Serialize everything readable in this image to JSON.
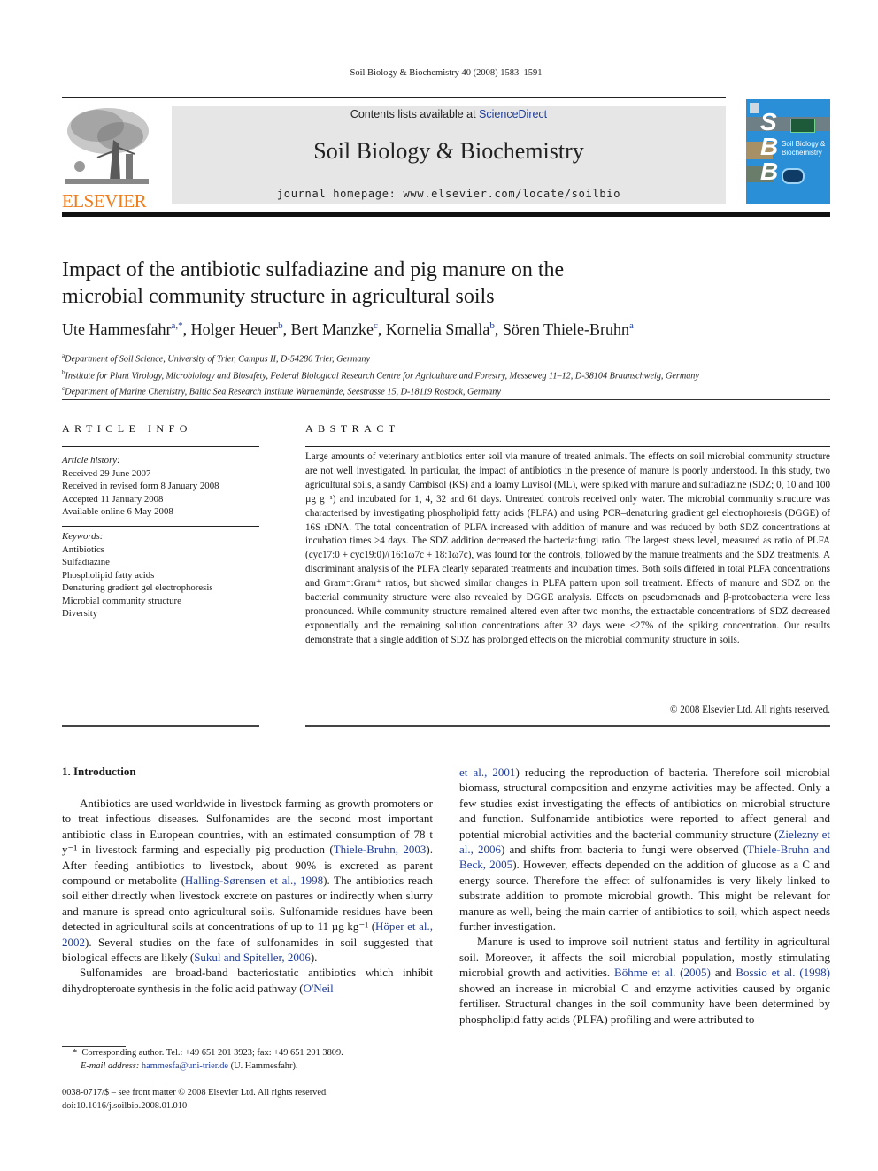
{
  "header": {
    "running_title": "Soil Biology & Biochemistry 40 (2008) 1583–1591",
    "contents_prefix": "Contents lists available at ",
    "contents_link": "ScienceDirect",
    "journal_title": "Soil Biology & Biochemistry",
    "homepage": "journal homepage: www.elsevier.com/locate/soilbio",
    "publisher_logo": "ELSEVIER",
    "cover": {
      "letters": [
        "S",
        "B",
        "B"
      ],
      "title_line1": "Soil Biology &",
      "title_line2": "Biochemistry"
    }
  },
  "colors": {
    "link": "#1f3d99",
    "elsevier_orange": "#f07d1c",
    "cover_blue": "#2a8fd6",
    "banner_gray": "#e6e6e6"
  },
  "article": {
    "title_line1": "Impact of the antibiotic sulfadiazine and pig manure on the",
    "title_line2": "microbial community structure in agricultural soils",
    "authors": [
      {
        "name": "Ute Hammesfahr",
        "sup": "a,*"
      },
      {
        "name": "Holger Heuer",
        "sup": "b"
      },
      {
        "name": "Bert Manzke",
        "sup": "c"
      },
      {
        "name": "Kornelia Smalla",
        "sup": "b"
      },
      {
        "name": "Sören Thiele-Bruhn",
        "sup": "a"
      }
    ],
    "affiliations": [
      {
        "sup": "a",
        "text": "Department of Soil Science, University of Trier, Campus II, D-54286 Trier, Germany"
      },
      {
        "sup": "b",
        "text": "Institute for Plant Virology, Microbiology and Biosafety, Federal Biological Research Centre for Agriculture and Forestry, Messeweg 11–12, D-38104 Braunschweig, Germany"
      },
      {
        "sup": "c",
        "text": "Department of Marine Chemistry, Baltic Sea Research Institute Warnemünde, Seestrasse 15, D-18119 Rostock, Germany"
      }
    ]
  },
  "article_info": {
    "heading": "ARTICLE INFO",
    "history_label": "Article history:",
    "history": [
      "Received 29 June 2007",
      "Received in revised form 8 January 2008",
      "Accepted 11 January 2008",
      "Available online 6 May 2008"
    ],
    "keywords_label": "Keywords:",
    "keywords": [
      "Antibiotics",
      "Sulfadiazine",
      "Phospholipid fatty acids",
      "Denaturing gradient gel electrophoresis",
      "Microbial community structure",
      "Diversity"
    ]
  },
  "abstract": {
    "heading": "ABSTRACT",
    "text": "Large amounts of veterinary antibiotics enter soil via manure of treated animals. The effects on soil microbial community structure are not well investigated. In particular, the impact of antibiotics in the presence of manure is poorly understood. In this study, two agricultural soils, a sandy Cambisol (KS) and a loamy Luvisol (ML), were spiked with manure and sulfadiazine (SDZ; 0, 10 and 100 µg g⁻¹) and incubated for 1, 4, 32 and 61 days. Untreated controls received only water. The microbial community structure was characterised by investigating phospholipid fatty acids (PLFA) and using PCR–denaturing gradient gel electrophoresis (DGGE) of 16S rDNA. The total concentration of PLFA increased with addition of manure and was reduced by both SDZ concentrations at incubation times >4 days. The SDZ addition decreased the bacteria:fungi ratio. The largest stress level, measured as ratio of PLFA (cyc17:0 + cyc19:0)/(16:1ω7c + 18:1ω7c), was found for the controls, followed by the manure treatments and the SDZ treatments. A discriminant analysis of the PLFA clearly separated treatments and incubation times. Both soils differed in total PLFA concentrations and Gram⁻:Gram⁺ ratios, but showed similar changes in PLFA pattern upon soil treatment. Effects of manure and SDZ on the bacterial community structure were also revealed by DGGE analysis. Effects on pseudomonads and β-proteobacteria were less pronounced. While community structure remained altered even after two months, the extractable concentrations of SDZ decreased exponentially and the remaining solution concentrations after 32 days were ≤27% of the spiking concentration. Our results demonstrate that a single addition of SDZ has prolonged effects on the microbial community structure in soils.",
    "copyright": "© 2008 Elsevier Ltd. All rights reserved."
  },
  "introduction": {
    "heading": "1.  Introduction",
    "left_p1": [
      {
        "t": "Antibiotics are used worldwide in livestock farming as growth promoters or to treat infectious diseases. Sulfonamides are the second most important antibiotic class in European countries, with an estimated consumption of 78 t y⁻¹ in livestock farming and especially pig production ("
      },
      {
        "t": "Thiele-Bruhn, 2003",
        "link": true
      },
      {
        "t": "). After feeding antibiotics to livestock, about 90% is excreted as parent compound or metabolite ("
      },
      {
        "t": "Halling-Sørensen et al., 1998",
        "link": true
      },
      {
        "t": "). The antibiotics reach soil either directly when livestock excrete on pastures or indirectly when slurry and manure is spread onto agricultural soils. Sulfon­amide residues have been detected in agricultural soils at concen­trations of up to 11 µg kg⁻¹ ("
      },
      {
        "t": "Höper et al., 2002",
        "link": true
      },
      {
        "t": "). Several studies on the fate of sulfonamides in soil suggested that biological effects are likely ("
      },
      {
        "t": "Sukul and Spiteller, 2006",
        "link": true
      },
      {
        "t": ")."
      }
    ],
    "left_p2": [
      {
        "t": "Sulfonamides are broad-band bacteriostatic antibiotics which inhibit dihydropteroate synthesis in the folic acid pathway ("
      },
      {
        "t": "O'Neil",
        "link": true
      }
    ],
    "right_p1": [
      {
        "t": "et al., 2001",
        "link": true
      },
      {
        "t": ") reducing the reproduction of bacteria. Therefore soil microbial biomass, structural composition and enzyme activities may be affected. Only a few studies exist investigating the effects of antibiotics on microbial structure and function. Sulfonamide anti­biotics were reported to affect general and potential microbial activities and the bacterial community structure ("
      },
      {
        "t": "Zielezny et al., 2006",
        "link": true
      },
      {
        "t": ") and shifts from bacteria to fungi were observed ("
      },
      {
        "t": "Thiele-Bruhn and Beck, 2005",
        "link": true
      },
      {
        "t": "). However, effects depended on the addition of glucose as a C and energy source. Therefore the effect of sulfonamides is very likely linked to substrate addition to promote microbial growth. This might be relevant for manure as well, being the main carrier of antibiotics to soil, which aspect needs further investigation."
      }
    ],
    "right_p2": [
      {
        "t": "Manure is used to improve soil nutrient status and fertility in agricultural soil. Moreover, it affects the soil microbial population, mostly stimulating microbial growth and activities. "
      },
      {
        "t": "Böhme et al. (2005)",
        "link": true
      },
      {
        "t": " and "
      },
      {
        "t": "Bossio et al. (1998)",
        "link": true
      },
      {
        "t": " showed an increase in microbial C and enzyme activities caused by organic fertiliser. Structural changes in the soil community have been determined by phospholipid fatty acids (PLFA) profiling and were attributed to"
      }
    ]
  },
  "footnote": {
    "marker": "*",
    "corresponding": "Corresponding author. Tel.: +49 651 201 3923; fax: +49 651 201 3809.",
    "email_label": "E-mail address:",
    "email": "hammesfa@uni-trier.de",
    "email_suffix": " (U. Hammesfahr)."
  },
  "front_matter": {
    "issn": "0038-0717/$ – see front matter © 2008 Elsevier Ltd. All rights reserved.",
    "doi": "doi:10.1016/j.soilbio.2008.01.010"
  }
}
